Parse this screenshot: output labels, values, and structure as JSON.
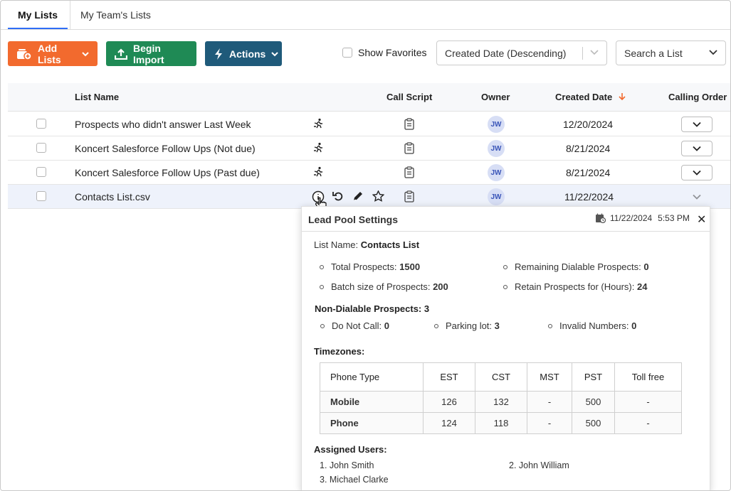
{
  "tabs": [
    {
      "label": "My Lists",
      "active": true
    },
    {
      "label": "My Team's Lists",
      "active": false
    }
  ],
  "toolbar": {
    "add_lists": "Add Lists",
    "begin_import": "Begin Import",
    "actions": "Actions",
    "show_favorites": "Show Favorites",
    "sort_value": "Created Date (Descending)",
    "search_value": "Search a List"
  },
  "table": {
    "headers": {
      "list_name": "List Name",
      "call_script": "Call Script",
      "owner": "Owner",
      "created_date": "Created Date",
      "calling_order": "Calling Order"
    },
    "rows": [
      {
        "name": "Prospects who didn't answer Last Week",
        "owner": "JW",
        "date": "12/20/2024"
      },
      {
        "name": "Koncert Salesforce Follow Ups (Not due)",
        "owner": "JW",
        "date": "8/21/2024"
      },
      {
        "name": "Koncert Salesforce Follow Ups (Past due)",
        "owner": "JW",
        "date": "8/21/2024"
      },
      {
        "name": "Contacts List.csv",
        "owner": "JW",
        "date": "11/22/2024"
      }
    ]
  },
  "popup": {
    "title": "Lead Pool Settings",
    "date": "11/22/2024",
    "time": "5:53 PM",
    "list_name_label": "List Name:",
    "list_name_value": "Contacts List",
    "total_label": "Total Prospects:",
    "total_value": "1500",
    "remaining_label": "Remaining Dialable Prospects:",
    "remaining_value": "0",
    "batch_label": "Batch size of Prospects:",
    "batch_value": "200",
    "retain_label": "Retain Prospects for (Hours):",
    "retain_value": "24",
    "non_dialable_label": "Non-Dialable Prospects:",
    "non_dialable_value": "3",
    "dnc_label": "Do Not Call:",
    "dnc_value": "0",
    "parking_label": "Parking lot:",
    "parking_value": "3",
    "invalid_label": "Invalid Numbers:",
    "invalid_value": "0",
    "timezones_label": "Timezones:",
    "tz_headers": [
      "Phone Type",
      "EST",
      "CST",
      "MST",
      "PST",
      "Toll free"
    ],
    "tz_rows": [
      [
        "Mobile",
        "126",
        "132",
        "-",
        "500",
        "-"
      ],
      [
        "Phone",
        "124",
        "118",
        "-",
        "500",
        "-"
      ]
    ],
    "assigned_label": "Assigned Users:",
    "users": [
      "1. John Smith",
      "2. John William",
      "3. Michael Clarke"
    ]
  },
  "colors": {
    "orange": "#f26a2e",
    "green": "#1f8a55",
    "teal": "#1f5a7a",
    "accent": "#2f6df6",
    "sort_arrow": "#f26a2e"
  }
}
